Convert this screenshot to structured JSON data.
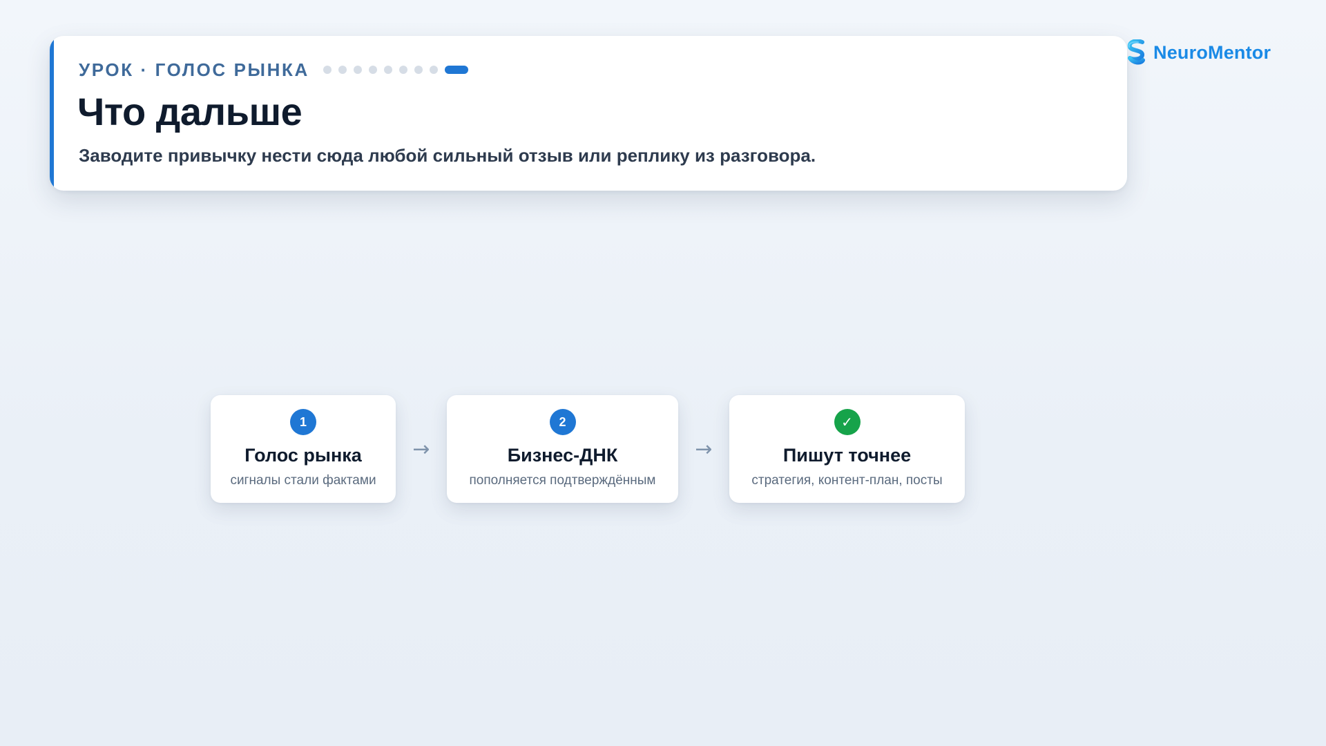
{
  "header": {
    "eyebrow": "УРОК · ГОЛОС РЫНКА",
    "progress": {
      "total": 9,
      "current": 9
    },
    "title": "Что дальше",
    "subtitle": "Заводите привычку нести сюда любой сильный отзыв или реплику из разговора."
  },
  "brand": {
    "name": "NeuroMentor",
    "icon": "neuromentor-logo-icon",
    "color": "#1a8ae6"
  },
  "flow": {
    "arrow_glyph": "→",
    "steps": [
      {
        "badge": "1",
        "title": "Голос рынка",
        "description": "сигналы стали фактами",
        "status": "numbered"
      },
      {
        "badge": "2",
        "title": "Бизнес-ДНК",
        "description": "пополняется подтверждённым",
        "status": "numbered"
      },
      {
        "badge": "✓",
        "title": "Пишут точнее",
        "description": "стратегия, контент-план, посты",
        "status": "done"
      }
    ]
  },
  "colors": {
    "accent": "#1f77d4",
    "success": "#16a34a",
    "dot_inactive": "#d6dde6"
  }
}
